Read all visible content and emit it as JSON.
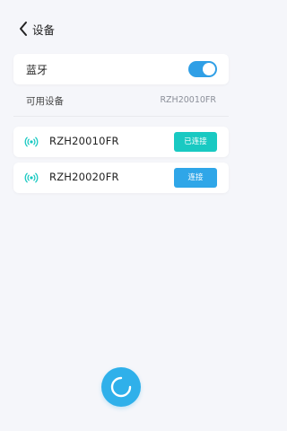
{
  "header": {
    "title": "设备"
  },
  "bluetooth": {
    "label": "蓝牙",
    "enabled": true
  },
  "available": {
    "label": "可用设备",
    "value": "RZH20010FR"
  },
  "devices": [
    {
      "name": "RZH20010FR",
      "button_label": "已连接",
      "state": "connected"
    },
    {
      "name": "RZH20020FR",
      "button_label": "连接",
      "state": "disconnected"
    }
  ],
  "colors": {
    "toggle_on": "#2f9fe6",
    "connected": "#19c9c2",
    "connect": "#2fa6e8",
    "refresh": "#2fb0ea",
    "device_icon": "#19c9c2"
  },
  "icons": {
    "back": "chevron-left-icon",
    "device": "signal-icon",
    "refresh": "refresh-icon"
  }
}
